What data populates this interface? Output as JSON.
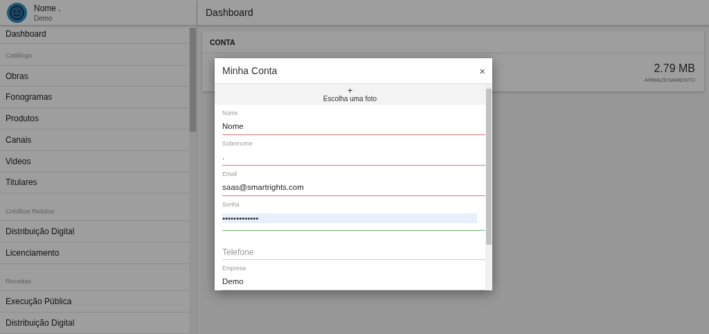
{
  "user": {
    "name": "Nome .",
    "company": "Demo"
  },
  "sidebar": {
    "items": [
      {
        "kind": "item",
        "label": "Dashboard"
      },
      {
        "kind": "section",
        "label": "Catálogo"
      },
      {
        "kind": "item",
        "label": "Obras"
      },
      {
        "kind": "item",
        "label": "Fonogramas"
      },
      {
        "kind": "item",
        "label": "Produtos"
      },
      {
        "kind": "item",
        "label": "Canais"
      },
      {
        "kind": "item",
        "label": "Videos"
      },
      {
        "kind": "item",
        "label": "Titulares"
      },
      {
        "kind": "section",
        "label": "Créditos Retidos"
      },
      {
        "kind": "item",
        "label": "Distribuição Digital"
      },
      {
        "kind": "item",
        "label": "Licenciamento"
      },
      {
        "kind": "section",
        "label": "Receitas"
      },
      {
        "kind": "item",
        "label": "Execução Pública"
      },
      {
        "kind": "item",
        "label": "Distribuição Digital"
      }
    ]
  },
  "header": {
    "title": "Dashboard"
  },
  "card": {
    "title": "CONTA",
    "stat_value": "2.79 MB",
    "stat_label": "ARMAZENAMENTO"
  },
  "dialog": {
    "title": "Minha Conta",
    "close": "×",
    "photo": {
      "icon": "+",
      "label": "Escolha uma foto"
    },
    "fields": [
      {
        "label": "Nome",
        "value": "Nome",
        "error": true,
        "valid": false
      },
      {
        "label": "Sobrenome",
        "value": ".",
        "error": true,
        "valid": false
      },
      {
        "label": "Email",
        "value": "saas@smartrights.com",
        "error": true,
        "valid": false
      },
      {
        "label": "Senha",
        "value": "•••••••••••••",
        "error": false,
        "valid": true,
        "autofilled": true
      },
      {
        "placeholder": "Telefone",
        "error": false,
        "valid": false
      },
      {
        "label": "Empresa",
        "value": "Demo",
        "error": false,
        "valid": false
      }
    ]
  }
}
